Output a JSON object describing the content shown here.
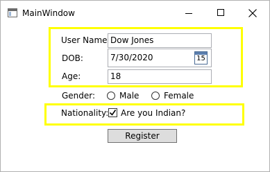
{
  "window": {
    "title": "MainWindow"
  },
  "form": {
    "user_name_label": "User Name:",
    "user_name_value": "Dow Jones",
    "dob_label": "DOB:",
    "dob_value": "7/30/2020",
    "calendar_icon_number": "15",
    "age_label": "Age:",
    "age_value": "18",
    "gender_label": "Gender:",
    "gender_options": [
      "Male",
      "Female"
    ],
    "gender_selected": null,
    "nationality_label": "Nationality:",
    "nationality_checkbox_label": "Are you Indian?",
    "nationality_checked": true,
    "register_label": "Register"
  },
  "highlight_color": "#ffff00",
  "icons": {
    "app": "window-app-icon",
    "minimize": "minimize-icon",
    "maximize": "maximize-icon",
    "close": "close-icon",
    "calendar": "calendar-icon",
    "check": "checkmark-icon"
  }
}
